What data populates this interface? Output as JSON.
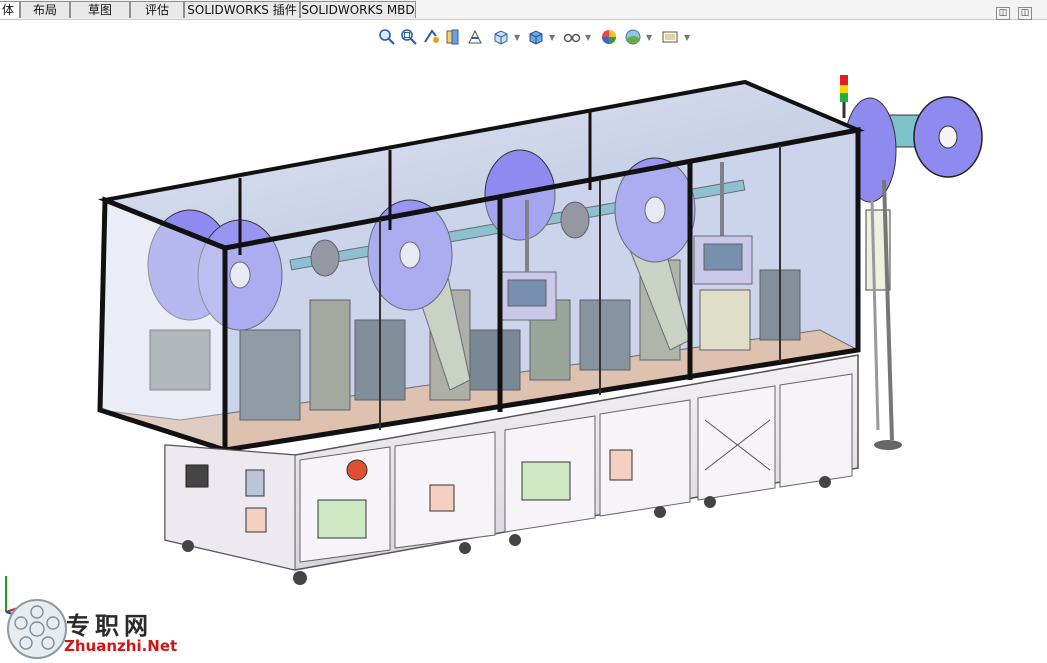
{
  "command_manager": {
    "tabs": [
      {
        "label": "体",
        "active": true
      },
      {
        "label": "布局",
        "active": false
      },
      {
        "label": "草图",
        "active": false
      },
      {
        "label": "评估",
        "active": false
      },
      {
        "label": "SOLIDWORKS 插件",
        "active": false
      },
      {
        "label": "SOLIDWORKS MBD",
        "active": false
      }
    ],
    "window_buttons": [
      "restore-left-icon",
      "restore-right-icon"
    ]
  },
  "heads_up_toolbar": {
    "buttons": [
      {
        "icon": "zoom-to-fit-icon"
      },
      {
        "icon": "zoom-to-area-icon"
      },
      {
        "icon": "previous-view-icon"
      },
      {
        "icon": "section-view-icon"
      },
      {
        "icon": "dynamic-annotation-view-icon"
      },
      {
        "icon": "view-orientation-icon",
        "dropdown": true
      },
      {
        "icon": "display-style-icon",
        "dropdown": true
      },
      {
        "icon": "hide-show-items-icon",
        "dropdown": true
      },
      {
        "icon": "edit-appearance-icon"
      },
      {
        "icon": "apply-scene-icon",
        "dropdown": true
      },
      {
        "icon": "view-settings-icon",
        "dropdown": true
      }
    ]
  },
  "graphics_area": {
    "model": "automated-assembly-machine-with-enclosure",
    "colors": {
      "frame": "#111111",
      "glass": "#c9d3ea",
      "reels": "#8f8af0",
      "base_cabinet": "#e6e3ea",
      "deck": "#e8b58f",
      "panels": "#2a2a2a",
      "signal_red": "#e02020",
      "signal_yellow": "#f5d400",
      "signal_green": "#20b040"
    }
  },
  "watermark": {
    "text_cn": "专职网",
    "text_en": "Zhuanzhi.Net"
  }
}
